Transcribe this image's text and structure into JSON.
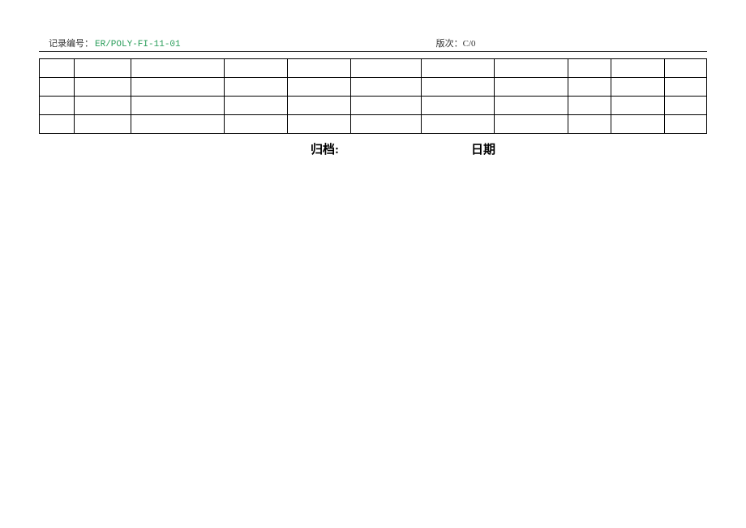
{
  "header": {
    "record_label": "记录编号：",
    "record_value": "ER/POLY-FI-11-01",
    "version_label": "版次：",
    "version_value": "C/0"
  },
  "table": {
    "rows": 4,
    "cols": 11
  },
  "footer": {
    "archive_label": "归档:",
    "date_label": "日期"
  }
}
